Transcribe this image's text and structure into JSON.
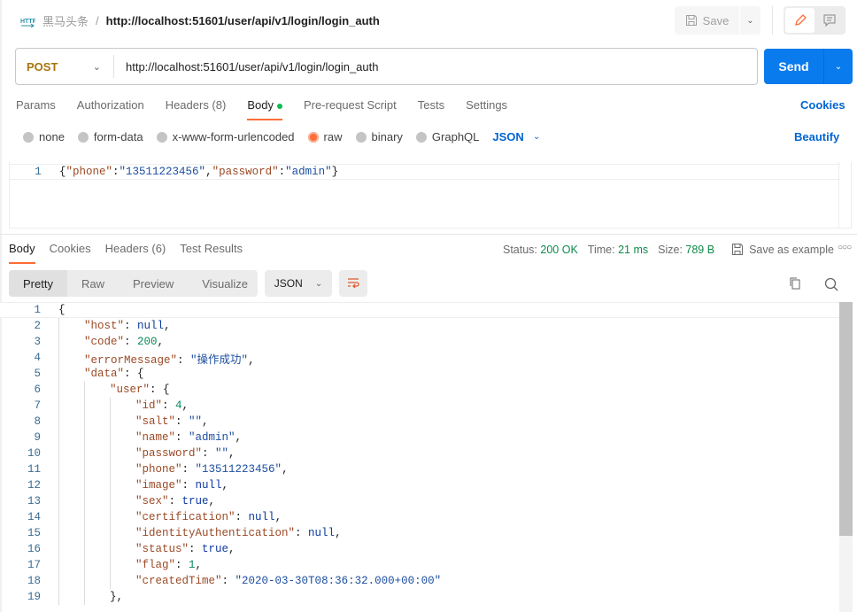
{
  "header": {
    "collection": "黑马头条",
    "separator": "/",
    "title": "http://localhost:51601/user/api/v1/login/login_auth",
    "save_label": "Save"
  },
  "request": {
    "method": "POST",
    "url": "http://localhost:51601/user/api/v1/login/login_auth",
    "send_label": "Send",
    "tabs": [
      {
        "label": "Params"
      },
      {
        "label": "Authorization"
      },
      {
        "label": "Headers (8)"
      },
      {
        "label": "Body",
        "active": true
      },
      {
        "label": "Pre-request Script"
      },
      {
        "label": "Tests"
      },
      {
        "label": "Settings"
      }
    ],
    "cookies_label": "Cookies",
    "body_types": [
      {
        "label": "none"
      },
      {
        "label": "form-data"
      },
      {
        "label": "x-www-form-urlencoded"
      },
      {
        "label": "raw",
        "selected": true
      },
      {
        "label": "binary"
      },
      {
        "label": "GraphQL"
      }
    ],
    "language": "JSON",
    "beautify_label": "Beautify",
    "body_line_number": "1",
    "body_tokens": [
      [
        "p",
        "{"
      ],
      [
        "k",
        "\"phone\""
      ],
      [
        "p",
        ":"
      ],
      [
        "s",
        "\"13511223456\""
      ],
      [
        "p",
        ","
      ],
      [
        "k",
        "\"password\""
      ],
      [
        "p",
        ":"
      ],
      [
        "s",
        "\"admin\""
      ],
      [
        "p",
        "}"
      ]
    ]
  },
  "response": {
    "tabs": [
      {
        "label": "Body",
        "active": true
      },
      {
        "label": "Cookies"
      },
      {
        "label": "Headers (6)"
      },
      {
        "label": "Test Results"
      }
    ],
    "status_label": "Status:",
    "status_value": "200 OK",
    "time_label": "Time:",
    "time_value": "21 ms",
    "size_label": "Size:",
    "size_value": "789 B",
    "save_example_label": "Save as example",
    "view_modes": [
      "Pretty",
      "Raw",
      "Preview",
      "Visualize"
    ],
    "format": "JSON",
    "lines": [
      {
        "n": "1",
        "i": 0,
        "t": [
          [
            "p",
            "{"
          ]
        ]
      },
      {
        "n": "2",
        "i": 1,
        "t": [
          [
            "k",
            "\"host\""
          ],
          [
            "p",
            ": "
          ],
          [
            "b",
            "null"
          ],
          [
            "p",
            ","
          ]
        ]
      },
      {
        "n": "3",
        "i": 1,
        "t": [
          [
            "k",
            "\"code\""
          ],
          [
            "p",
            ": "
          ],
          [
            "n",
            "200"
          ],
          [
            "p",
            ","
          ]
        ]
      },
      {
        "n": "4",
        "i": 1,
        "t": [
          [
            "k",
            "\"errorMessage\""
          ],
          [
            "p",
            ": "
          ],
          [
            "s",
            "\"操作成功\""
          ],
          [
            "p",
            ","
          ]
        ]
      },
      {
        "n": "5",
        "i": 1,
        "t": [
          [
            "k",
            "\"data\""
          ],
          [
            "p",
            ": {"
          ]
        ]
      },
      {
        "n": "6",
        "i": 2,
        "t": [
          [
            "k",
            "\"user\""
          ],
          [
            "p",
            ": {"
          ]
        ]
      },
      {
        "n": "7",
        "i": 3,
        "t": [
          [
            "k",
            "\"id\""
          ],
          [
            "p",
            ": "
          ],
          [
            "n",
            "4"
          ],
          [
            "p",
            ","
          ]
        ]
      },
      {
        "n": "8",
        "i": 3,
        "t": [
          [
            "k",
            "\"salt\""
          ],
          [
            "p",
            ": "
          ],
          [
            "s",
            "\"\""
          ],
          [
            "p",
            ","
          ]
        ]
      },
      {
        "n": "9",
        "i": 3,
        "t": [
          [
            "k",
            "\"name\""
          ],
          [
            "p",
            ": "
          ],
          [
            "s",
            "\"admin\""
          ],
          [
            "p",
            ","
          ]
        ]
      },
      {
        "n": "10",
        "i": 3,
        "t": [
          [
            "k",
            "\"password\""
          ],
          [
            "p",
            ": "
          ],
          [
            "s",
            "\"\""
          ],
          [
            "p",
            ","
          ]
        ]
      },
      {
        "n": "11",
        "i": 3,
        "t": [
          [
            "k",
            "\"phone\""
          ],
          [
            "p",
            ": "
          ],
          [
            "s",
            "\"13511223456\""
          ],
          [
            "p",
            ","
          ]
        ]
      },
      {
        "n": "12",
        "i": 3,
        "t": [
          [
            "k",
            "\"image\""
          ],
          [
            "p",
            ": "
          ],
          [
            "b",
            "null"
          ],
          [
            "p",
            ","
          ]
        ]
      },
      {
        "n": "13",
        "i": 3,
        "t": [
          [
            "k",
            "\"sex\""
          ],
          [
            "p",
            ": "
          ],
          [
            "b",
            "true"
          ],
          [
            "p",
            ","
          ]
        ]
      },
      {
        "n": "14",
        "i": 3,
        "t": [
          [
            "k",
            "\"certification\""
          ],
          [
            "p",
            ": "
          ],
          [
            "b",
            "null"
          ],
          [
            "p",
            ","
          ]
        ]
      },
      {
        "n": "15",
        "i": 3,
        "t": [
          [
            "k",
            "\"identityAuthentication\""
          ],
          [
            "p",
            ": "
          ],
          [
            "b",
            "null"
          ],
          [
            "p",
            ","
          ]
        ]
      },
      {
        "n": "16",
        "i": 3,
        "t": [
          [
            "k",
            "\"status\""
          ],
          [
            "p",
            ": "
          ],
          [
            "b",
            "true"
          ],
          [
            "p",
            ","
          ]
        ]
      },
      {
        "n": "17",
        "i": 3,
        "t": [
          [
            "k",
            "\"flag\""
          ],
          [
            "p",
            ": "
          ],
          [
            "n",
            "1"
          ],
          [
            "p",
            ","
          ]
        ]
      },
      {
        "n": "18",
        "i": 3,
        "t": [
          [
            "k",
            "\"createdTime\""
          ],
          [
            "p",
            ": "
          ],
          [
            "s",
            "\"2020-03-30T08:36:32.000+00:00\""
          ]
        ]
      },
      {
        "n": "19",
        "i": 2,
        "t": [
          [
            "p",
            "},"
          ]
        ]
      }
    ]
  },
  "colors": {
    "accent": "#ff6c37",
    "send": "#097bed",
    "link": "#0265d2",
    "status_ok": "#0f8a4a",
    "method": "#a8740c"
  }
}
